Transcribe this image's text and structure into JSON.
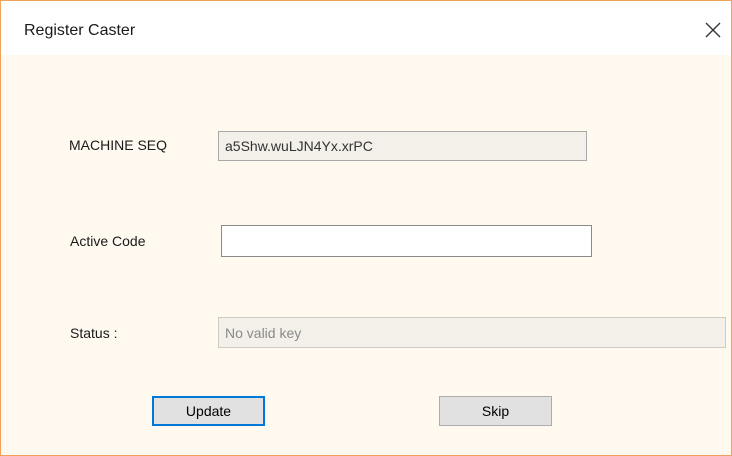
{
  "window": {
    "title": "Register Caster"
  },
  "form": {
    "machine_seq_label": "MACHINE SEQ",
    "machine_seq_value": "a5Shw.wuLJN4Yx.xrPC",
    "active_code_label": "Active Code",
    "active_code_value": "",
    "status_label": "Status :",
    "status_value": "No valid key"
  },
  "buttons": {
    "update_label": "Update",
    "skip_label": "Skip"
  },
  "icons": {
    "close": "close-icon"
  },
  "colors": {
    "window_border": "#f0a35a",
    "client_background": "#fff9f0",
    "default_button_border": "#0078d7",
    "button_face": "#e1e1e1"
  }
}
